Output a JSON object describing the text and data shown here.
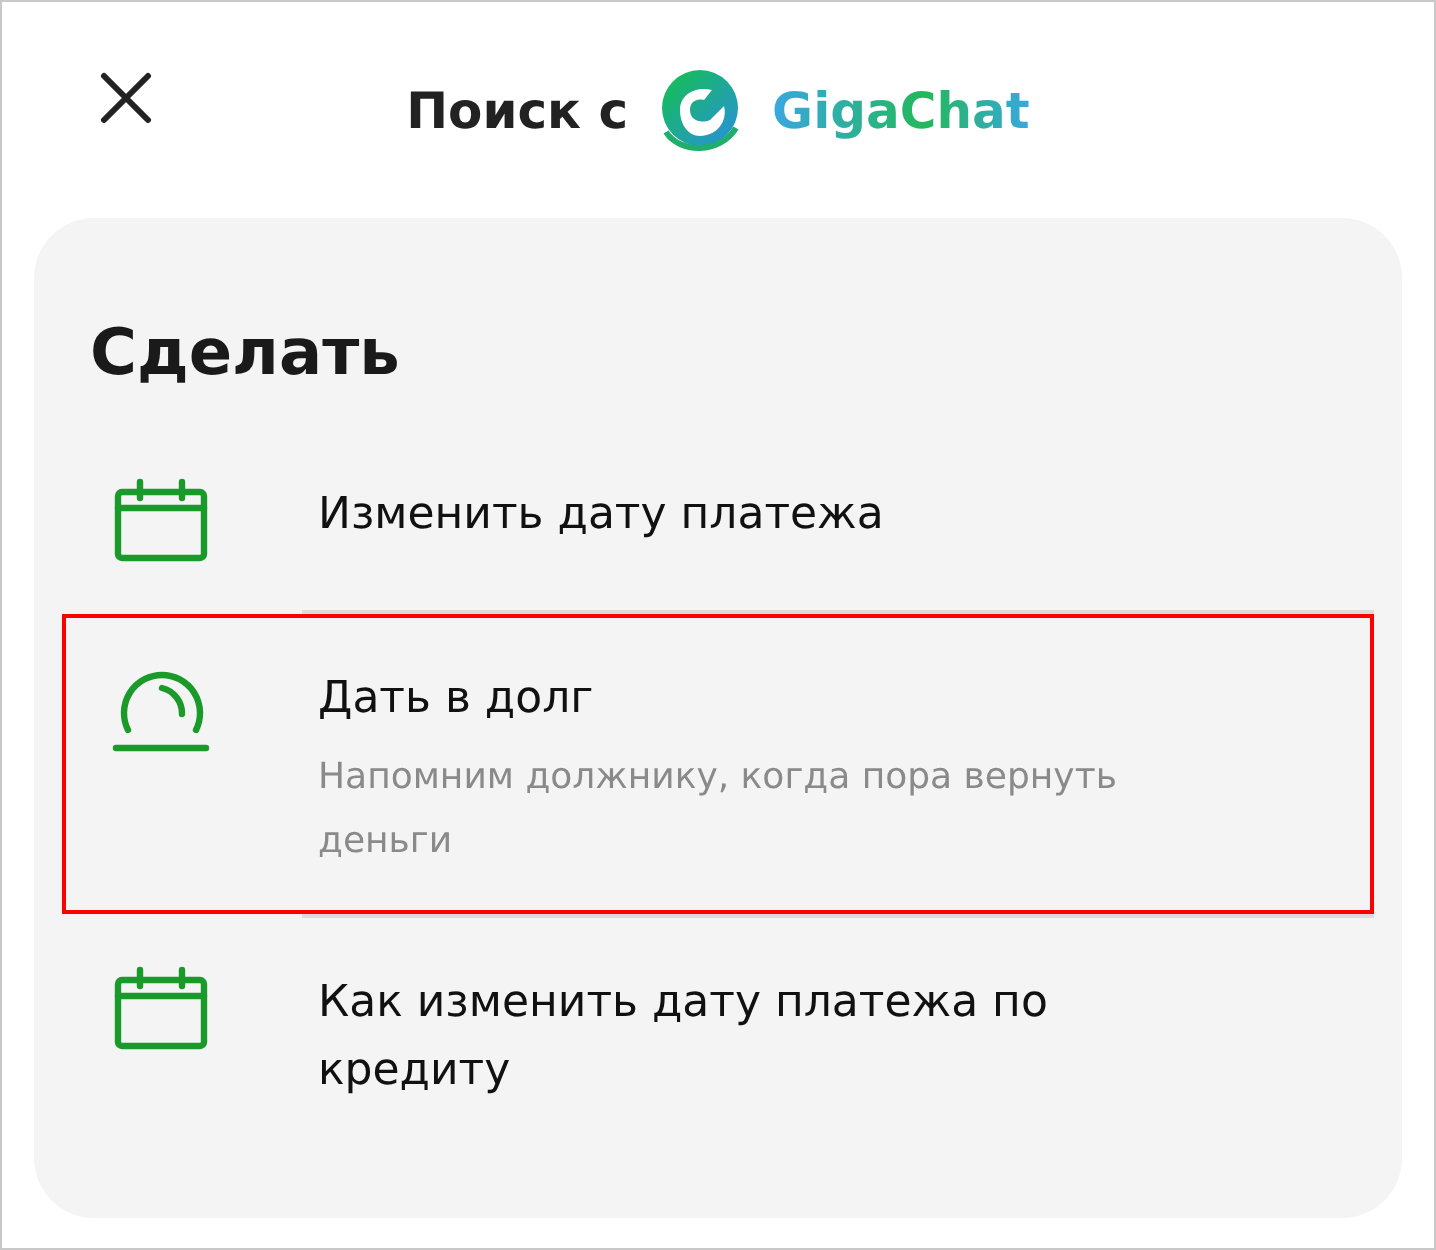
{
  "header": {
    "title": "Поиск с",
    "brand": "GigaChat"
  },
  "section": {
    "title": "Сделать",
    "items": [
      {
        "kind": "calendar",
        "title": "Изменить дату платежа",
        "highlighted": false
      },
      {
        "kind": "gauge",
        "title": "Дать в долг",
        "subtitle": "Напомним должнику, когда пора вернуть деньги",
        "highlighted": true
      },
      {
        "kind": "calendar",
        "title": "Как изменить дату платежа по кредиту",
        "highlighted": false
      }
    ]
  }
}
